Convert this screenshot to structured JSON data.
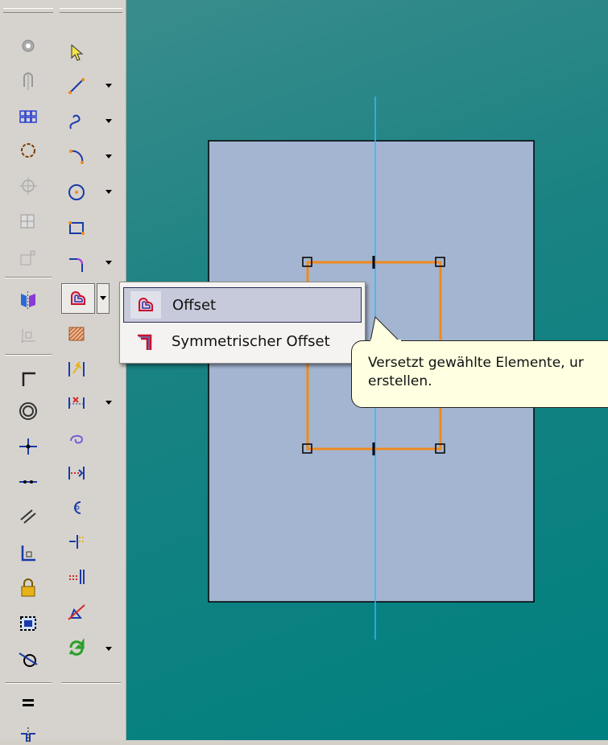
{
  "flyout": {
    "items": [
      {
        "label": "Offset",
        "icon": "offset-icon",
        "highlighted": true
      },
      {
        "label": "Symmetrischer Offset",
        "icon": "symmetric-offset-icon",
        "highlighted": false
      }
    ]
  },
  "tooltip": {
    "line1": "Versetzt gewählte Elemente, ur",
    "line2": "erstellen."
  },
  "toolbar_left": [
    "point-icon",
    "hole-icon",
    "array-icon",
    "circular-pattern-icon",
    "centerpoint-icon",
    "grid-icon",
    "rectangle-icon",
    "mirror-icon",
    "dimension-icon",
    "perpendicular-icon",
    "concentric-icon",
    "coincident-icon",
    "collinear-icon",
    "parallel-icon",
    "fix-icon",
    "lock-icon",
    "show-constraints-icon",
    "tangent-icon",
    "equal-icon",
    "symmetric-icon"
  ],
  "toolbar_right": [
    "select-arrow-icon",
    "line-icon",
    "spline-icon",
    "arc-icon",
    "circle-icon",
    "rectangle-icon",
    "fillet-icon",
    "offset-tool-icon",
    "hatch-icon",
    "project-geometry-icon",
    "move-icon",
    "rotate-icon",
    "trim-icon",
    "extend-icon",
    "split-icon",
    "mirror-sketch-icon",
    "sketch-update-icon"
  ],
  "colors": {
    "canvas": "#008080",
    "part": "#a3b5d1",
    "sketch_line": "#f08a1e",
    "axis_line": "#3ab3ff",
    "tooltip_bg": "#ffffe1",
    "flyout_highlight": "#c7cadb"
  }
}
